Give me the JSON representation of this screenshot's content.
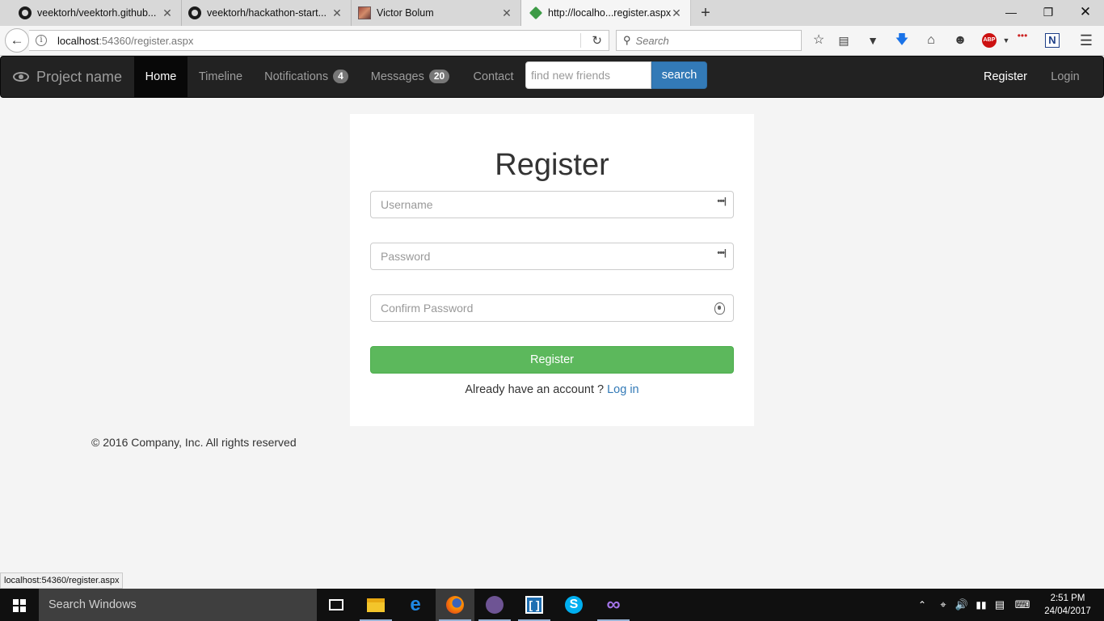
{
  "browser": {
    "tabs": [
      {
        "title": "veektorh/veektorh.github...",
        "favicon": "github-icon"
      },
      {
        "title": "veektorh/hackathon-start...",
        "favicon": "github-icon"
      },
      {
        "title": "Victor Bolum",
        "favicon": "photo-icon"
      },
      {
        "title": "http://localho...register.aspx",
        "favicon": "cube-icon"
      }
    ],
    "url_host": "localhost",
    "url_path": ":54360/register.aspx",
    "search_placeholder": "Search",
    "abp_label": "ABP",
    "n_label": "N",
    "status_url": "localhost:54360/register.aspx"
  },
  "site": {
    "brand": "Project name",
    "nav": {
      "home": "Home",
      "timeline": "Timeline",
      "notifications": "Notifications",
      "notifications_count": "4",
      "messages": "Messages",
      "messages_count": "20",
      "contact": "Contact"
    },
    "friend_search_placeholder": "find new friends",
    "search_button": "search",
    "register_link": "Register",
    "login_link": "Login"
  },
  "form": {
    "title": "Register",
    "username_placeholder": "Username",
    "password_placeholder": "Password",
    "confirm_placeholder": "Confirm Password",
    "submit": "Register",
    "already_text": "Already have an account ?",
    "login_link": "Log in"
  },
  "footer": "© 2016 Company, Inc. All rights reserved",
  "taskbar": {
    "search_placeholder": "Search Windows",
    "time": "2:51 PM",
    "date": "24/04/2017"
  },
  "colors": {
    "navbar": "#222222",
    "register_button": "#5cb85c",
    "search_button": "#337ab7",
    "link": "#337ab7"
  }
}
